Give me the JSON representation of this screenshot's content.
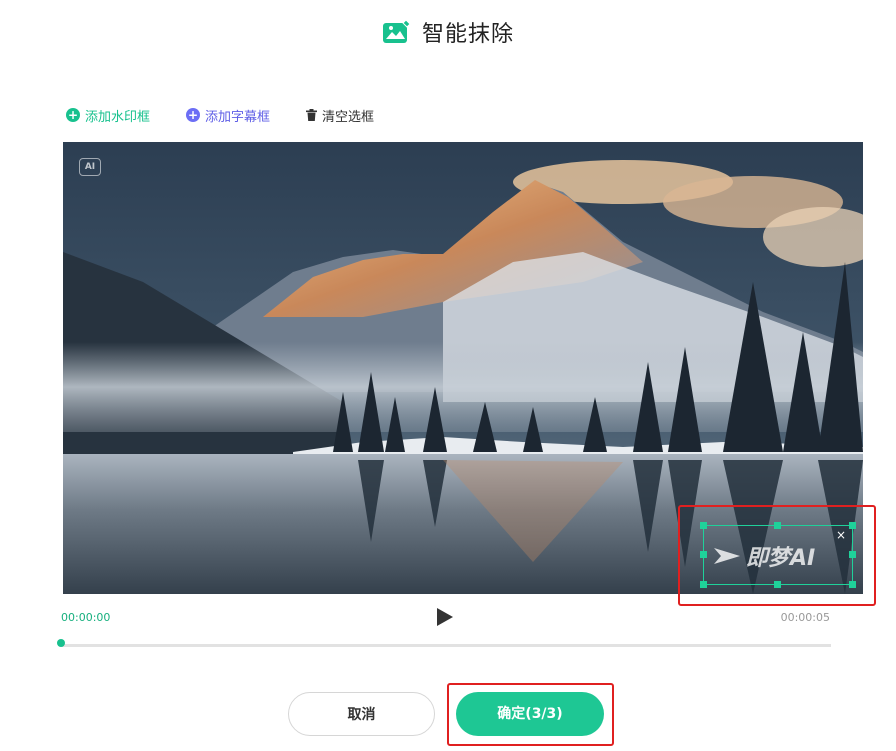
{
  "header": {
    "title": "智能抹除",
    "icon": "image-edit-icon",
    "accent": "#18c18e"
  },
  "toolbar": {
    "add_watermark_label": "添加水印框",
    "add_subtitle_label": "添加字幕框",
    "clear_label": "清空选框",
    "watermark_color": "#18c18e",
    "subtitle_color": "#6c6ef5"
  },
  "video": {
    "ai_badge": "AI",
    "watermark_text": "即梦AI"
  },
  "player": {
    "current_time": "00:00:00",
    "duration": "00:00:05",
    "progress": 0
  },
  "actions": {
    "cancel_label": "取消",
    "confirm_label": "确定(3/3)"
  }
}
